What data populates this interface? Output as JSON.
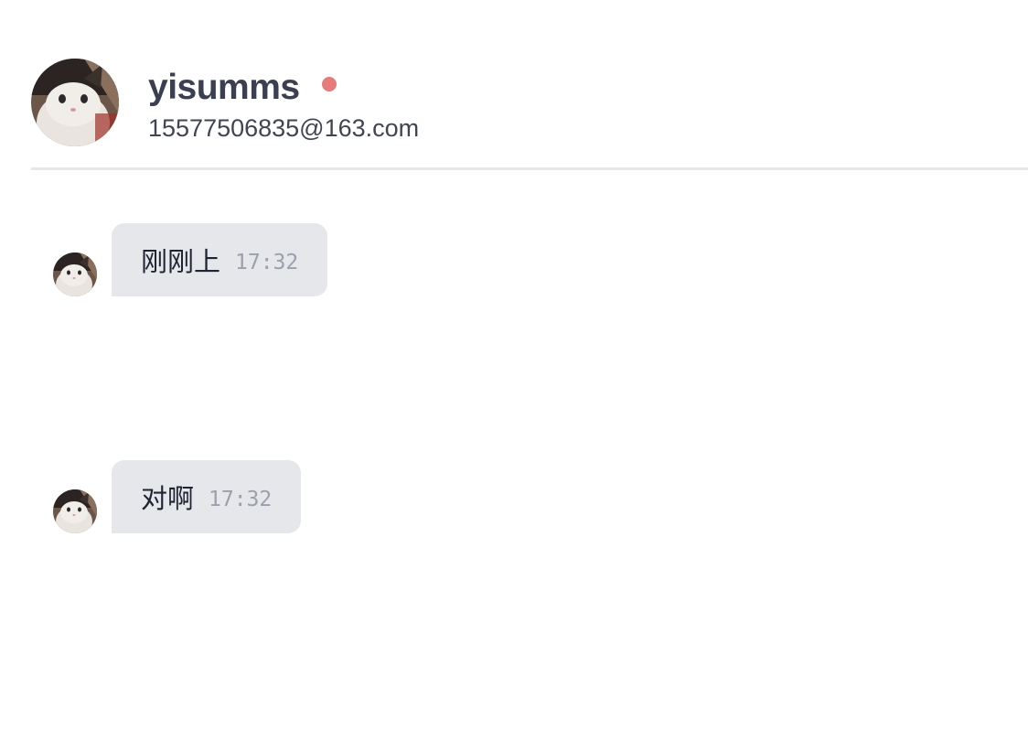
{
  "header": {
    "username": "yisumms",
    "email": "15577506835@163.com",
    "status_color": "#e87a7a",
    "avatar_icon": "cat-avatar-icon"
  },
  "messages": [
    {
      "text": "刚刚上",
      "time": "17:32"
    },
    {
      "text": "对啊",
      "time": "17:32"
    }
  ],
  "colors": {
    "bubble_bg": "#e5e7eb",
    "divider": "#e5e7eb",
    "username": "#3a4051"
  }
}
